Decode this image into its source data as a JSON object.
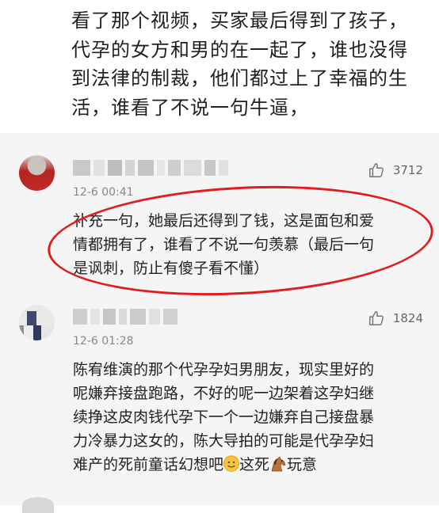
{
  "main_comment": {
    "lines": [
      "看了那个视频，买家最后得到了孩子，",
      "代孕的女方和男的在一起了，谁也没得",
      "到法律的制裁，他们都过上了幸福的生",
      "活，谁看了不说一句牛逼，"
    ]
  },
  "replies": [
    {
      "username": "",
      "like_count": "3712",
      "time": "12-6 00:41",
      "text_lines": [
        "补充一句，她最后还得到了钱，这是面包和爱",
        "情都拥有了，谁看了不说一句羡慕（最后一句",
        "是讽刺，防止有傻子看不懂）"
      ]
    },
    {
      "username": "",
      "like_count": "1824",
      "time": "12-6 01:28",
      "text_lines": [
        "陈宥维演的那个代孕孕妇男朋友，现实里好的",
        "呢嫌弃接盘跑路，不好的呢一边架着这孕妇继",
        "续挣这皮肉钱代孕下一个一边嫌弃自己接盘暴",
        "力冷暴力这女的，陈大导拍的可能是代孕孕妇"
      ],
      "last_line_parts": [
        "难产的死前童话幻想吧",
        "这死",
        "玩意"
      ]
    }
  ],
  "colors": {
    "highlight_ellipse": "#e21d1d",
    "reply_background": "#f5f5f5",
    "meta_text": "#888888"
  },
  "icons": [
    "thumbs-up-icon",
    "slight-smile-emoji-icon",
    "horse-emoji-icon"
  ]
}
